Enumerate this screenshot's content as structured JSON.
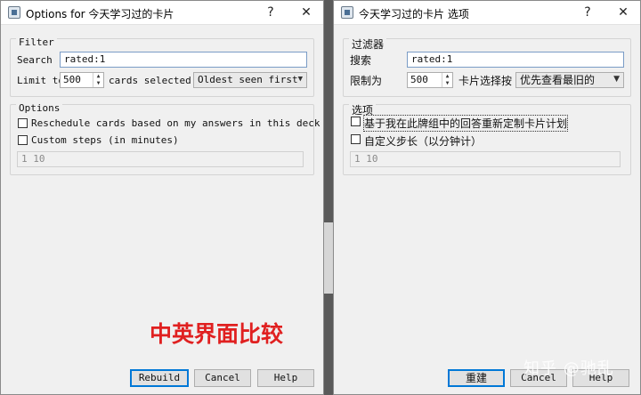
{
  "left_dialog": {
    "title": "Options for 今天学习过的卡片",
    "help_glyph": "?",
    "close_glyph": "✕",
    "filter": {
      "group_label": "Filter",
      "search_label": "Search",
      "search_value": "rated:1",
      "limit_label": "Limit to",
      "limit_value": "500",
      "cards_selected_by_label": "cards selected by",
      "order_value": "Oldest seen first"
    },
    "options": {
      "group_label": "Options",
      "reschedule_label": "Reschedule cards based on my answers in this deck",
      "custom_steps_label": "Custom steps (in minutes)",
      "steps_value": "1 10"
    },
    "buttons": {
      "rebuild": "Rebuild",
      "cancel": "Cancel",
      "help": "Help"
    }
  },
  "right_dialog": {
    "title": "今天学习过的卡片 选项",
    "help_glyph": "?",
    "close_glyph": "✕",
    "filter": {
      "group_label": "过滤器",
      "search_label": "搜索",
      "search_value": "rated:1",
      "limit_label": "限制为",
      "limit_value": "500",
      "cards_selected_by_label": "卡片选择按",
      "order_value": "优先查看最旧的"
    },
    "options": {
      "group_label": "选项",
      "reschedule_label": "基于我在此牌组中的回答重新定制卡片计划",
      "custom_steps_label": "自定义步长（以分钟计）",
      "steps_value": "1 10"
    },
    "buttons": {
      "rebuild": "重建",
      "cancel": "Cancel",
      "help": "Help"
    }
  },
  "overlay_caption": "中英界面比较",
  "watermark": "知乎 @驰乱",
  "colors": {
    "caption": "#e02020",
    "focus_border": "#0078d7",
    "input_focus": "#7a9cc6"
  }
}
